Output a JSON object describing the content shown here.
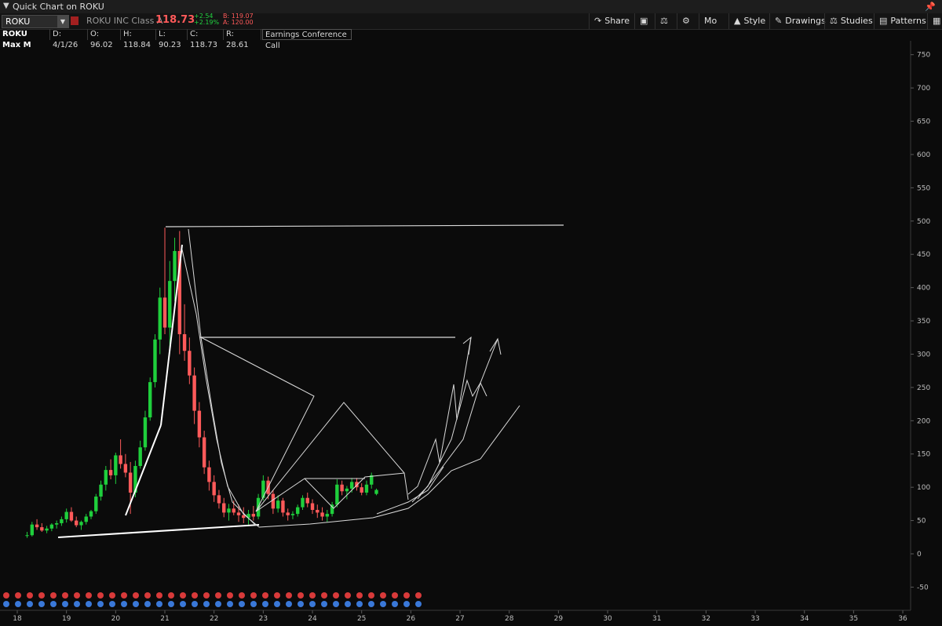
{
  "window": {
    "title": "Quick Chart on ROKU"
  },
  "quote": {
    "symbol": "ROKU",
    "company": "ROKU INC Class A",
    "last": "118.73",
    "change": "+2.54",
    "change_pct": "+2.19%",
    "bid": "B: 119.07",
    "ask": "A: 120.00"
  },
  "toolbar": {
    "share": "Share",
    "mo": "Mo",
    "style": "Style",
    "drawings": "Drawings",
    "studies": "Studies",
    "patterns": "Patterns"
  },
  "infobar": {
    "name": "ROKU Max M",
    "date": "D: 4/1/26",
    "open": "O: 96.02",
    "high": "H: 118.84",
    "low": "L: 90.23",
    "close": "C: 118.73",
    "range": "R: 28.61",
    "event": "Earnings Conference Call"
  },
  "colors": {
    "up": "#1fcf3c",
    "down": "#ff5a5a",
    "drawing": "#d9d9d9"
  },
  "chart_data": {
    "type": "candlestick",
    "xlabel": "",
    "ylabel": "",
    "x_ticks": [
      "18",
      "19",
      "20",
      "21",
      "22",
      "23",
      "24",
      "25",
      "26",
      "27",
      "28",
      "29",
      "30",
      "31",
      "32",
      "33",
      "34",
      "35",
      "36"
    ],
    "y_ticks": [
      750,
      700,
      650,
      600,
      550,
      500,
      450,
      400,
      350,
      300,
      250,
      200,
      150,
      100,
      50,
      0,
      -50
    ],
    "ylim": [
      -90,
      770
    ],
    "grid": false,
    "ohlc_monthly": [
      [
        18.2,
        27,
        33,
        24,
        28
      ],
      [
        18.3,
        28,
        48,
        26,
        44
      ],
      [
        18.4,
        44,
        52,
        36,
        40
      ],
      [
        18.5,
        40,
        46,
        33,
        35
      ],
      [
        18.6,
        35,
        42,
        31,
        38
      ],
      [
        18.7,
        38,
        46,
        34,
        44
      ],
      [
        18.8,
        44,
        50,
        38,
        46
      ],
      [
        18.9,
        46,
        56,
        42,
        52
      ],
      [
        19.0,
        52,
        68,
        47,
        63
      ],
      [
        19.1,
        63,
        70,
        48,
        50
      ],
      [
        19.2,
        50,
        56,
        40,
        43
      ],
      [
        19.3,
        43,
        50,
        36,
        48
      ],
      [
        19.4,
        48,
        60,
        44,
        56
      ],
      [
        19.5,
        56,
        66,
        52,
        64
      ],
      [
        19.6,
        64,
        90,
        60,
        86
      ],
      [
        19.7,
        86,
        110,
        80,
        104
      ],
      [
        19.8,
        104,
        132,
        95,
        126
      ],
      [
        19.9,
        126,
        142,
        112,
        118
      ],
      [
        20.0,
        118,
        152,
        105,
        148
      ],
      [
        20.1,
        148,
        172,
        128,
        135
      ],
      [
        20.2,
        135,
        150,
        115,
        122
      ],
      [
        20.3,
        122,
        138,
        60,
        92
      ],
      [
        20.4,
        92,
        140,
        85,
        132
      ],
      [
        20.5,
        132,
        170,
        128,
        160
      ],
      [
        20.6,
        160,
        215,
        155,
        205
      ],
      [
        20.7,
        205,
        265,
        200,
        258
      ],
      [
        20.8,
        258,
        330,
        250,
        322
      ],
      [
        20.9,
        322,
        400,
        300,
        385
      ],
      [
        21.0,
        385,
        490,
        330,
        340
      ],
      [
        21.1,
        340,
        440,
        310,
        410
      ],
      [
        21.2,
        410,
        475,
        380,
        455
      ],
      [
        21.3,
        455,
        485,
        300,
        330
      ],
      [
        21.4,
        330,
        375,
        290,
        305
      ],
      [
        21.5,
        305,
        325,
        255,
        268
      ],
      [
        21.6,
        268,
        280,
        195,
        215
      ],
      [
        21.7,
        215,
        228,
        160,
        175
      ],
      [
        21.8,
        175,
        185,
        120,
        130
      ],
      [
        21.9,
        130,
        140,
        95,
        108
      ],
      [
        22.0,
        108,
        118,
        78,
        88
      ],
      [
        22.1,
        88,
        96,
        68,
        76
      ],
      [
        22.2,
        76,
        84,
        55,
        62
      ],
      [
        22.3,
        62,
        75,
        50,
        68
      ],
      [
        22.4,
        68,
        80,
        58,
        62
      ],
      [
        22.5,
        62,
        74,
        48,
        58
      ],
      [
        22.6,
        58,
        70,
        46,
        54
      ],
      [
        22.7,
        54,
        66,
        44,
        60
      ],
      [
        22.8,
        60,
        72,
        50,
        56
      ],
      [
        22.9,
        56,
        90,
        52,
        84
      ],
      [
        23.0,
        84,
        118,
        80,
        110
      ],
      [
        23.1,
        110,
        116,
        82,
        90
      ],
      [
        23.2,
        90,
        96,
        60,
        68
      ],
      [
        23.3,
        68,
        88,
        62,
        80
      ],
      [
        23.4,
        80,
        84,
        56,
        62
      ],
      [
        23.5,
        62,
        68,
        50,
        58
      ],
      [
        23.6,
        58,
        64,
        52,
        60
      ],
      [
        23.7,
        60,
        74,
        56,
        70
      ],
      [
        23.8,
        70,
        88,
        66,
        84
      ],
      [
        23.9,
        84,
        92,
        70,
        76
      ],
      [
        24.0,
        76,
        82,
        60,
        66
      ],
      [
        24.1,
        66,
        74,
        54,
        62
      ],
      [
        24.2,
        62,
        70,
        50,
        56
      ],
      [
        24.3,
        56,
        66,
        48,
        60
      ],
      [
        24.4,
        60,
        78,
        56,
        74
      ],
      [
        24.5,
        74,
        112,
        70,
        104
      ],
      [
        24.6,
        104,
        110,
        88,
        94
      ],
      [
        24.7,
        94,
        102,
        82,
        98
      ],
      [
        24.8,
        98,
        114,
        92,
        108
      ],
      [
        24.9,
        108,
        114,
        95,
        100
      ],
      [
        25.0,
        100,
        106,
        88,
        92
      ],
      [
        25.1,
        92,
        110,
        88,
        104
      ],
      [
        25.2,
        104,
        122,
        98,
        118
      ],
      [
        25.3,
        90,
        98,
        88,
        96
      ]
    ]
  }
}
